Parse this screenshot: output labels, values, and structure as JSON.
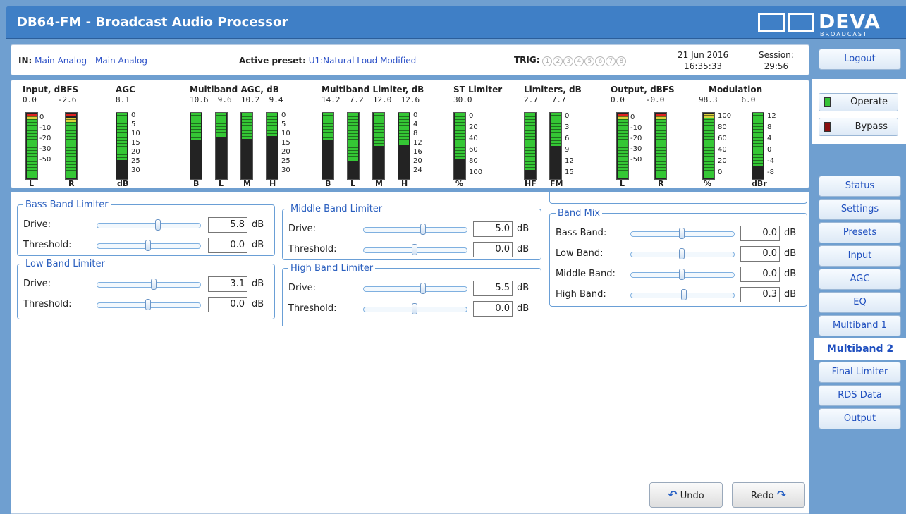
{
  "app": {
    "title": "DB64-FM - Broadcast Audio Processor",
    "logo_text": "DEVA",
    "logo_sub": "BROADCAST"
  },
  "info": {
    "in_label": "IN:",
    "in_value": "Main Analog - Main Analog",
    "preset_label": "Active preset:",
    "preset_value": "U1:Natural Loud Modified",
    "trig_label": "TRIG:",
    "trig": [
      "1",
      "2",
      "3",
      "4",
      "5",
      "6",
      "7",
      "8"
    ],
    "date": "21 Jun 2016",
    "time": "16:35:33",
    "session_label": "Session:",
    "session_value": "29:56"
  },
  "meters": {
    "input": {
      "title": "Input, dBFS",
      "l": "0.0",
      "r": "-2.6",
      "scale": [
        "0",
        "-10",
        "-20",
        "-30",
        "-50"
      ],
      "bars": [
        "L",
        "R"
      ]
    },
    "agc": {
      "title": "AGC",
      "v": "8.1",
      "scale": [
        "0",
        "5",
        "10",
        "15",
        "20",
        "25",
        "30"
      ],
      "bars": [
        "dB"
      ]
    },
    "mb_agc": {
      "title": "Multiband AGC, dB",
      "vals": [
        "10.6",
        "9.6",
        "10.2",
        "9.4"
      ],
      "scale": [
        "0",
        "5",
        "10",
        "15",
        "20",
        "25",
        "30"
      ],
      "bars": [
        "B",
        "L",
        "M",
        "H"
      ]
    },
    "mb_lim": {
      "title": "Multiband Limiter, dB",
      "vals": [
        "14.2",
        "7.2",
        "12.0",
        "12.6"
      ],
      "scale": [
        "0",
        "4",
        "8",
        "12",
        "16",
        "20",
        "24"
      ],
      "bars": [
        "B",
        "L",
        "M",
        "H"
      ]
    },
    "st_lim": {
      "title": "ST Limiter",
      "v": "30.0",
      "scale": [
        "0",
        "20",
        "40",
        "60",
        "80",
        "100"
      ],
      "bars": [
        "%"
      ]
    },
    "limiters": {
      "title": "Limiters, dB",
      "vals": [
        "2.7",
        "7.7"
      ],
      "scale": [
        "0",
        "3",
        "6",
        "9",
        "12",
        "15"
      ],
      "bars": [
        "HF",
        "FM"
      ]
    },
    "output": {
      "title": "Output, dBFS",
      "l": "0.0",
      "r": "-0.0",
      "scale": [
        "0",
        "-10",
        "-20",
        "-30",
        "-50"
      ],
      "bars": [
        "L",
        "R"
      ]
    },
    "modulation": {
      "title": "Modulation",
      "vals": [
        "98.3",
        "6.0"
      ],
      "scale_pct": [
        "100",
        "80",
        "60",
        "40",
        "20",
        "0"
      ],
      "scale_dbr": [
        "12",
        "8",
        "4",
        "0",
        "-4",
        "-8"
      ],
      "bars": [
        "%",
        "dBr"
      ]
    }
  },
  "groups": {
    "bass": {
      "legend": "Bass Band Limiter",
      "drive_label": "Drive:",
      "drive": "5.8",
      "threshold_label": "Threshold:",
      "threshold": "0.0",
      "unit": "dB"
    },
    "low": {
      "legend": "Low Band Limiter",
      "drive_label": "Drive:",
      "drive": "3.1",
      "threshold_label": "Threshold:",
      "threshold": "0.0",
      "unit": "dB"
    },
    "middle": {
      "legend": "Middle Band Limiter",
      "drive_label": "Drive:",
      "drive": "5.0",
      "threshold_label": "Threshold:",
      "threshold": "0.0",
      "unit": "dB"
    },
    "high": {
      "legend": "High Band Limiter",
      "drive_label": "Drive:",
      "drive": "5.5",
      "threshold_label": "Threshold:",
      "threshold": "0.0",
      "unit": "dB"
    },
    "mix": {
      "legend": "Band Mix",
      "bass_label": "Bass Band:",
      "bass": "0.0",
      "low_label": "Low Band:",
      "low": "0.0",
      "middle_label": "Middle Band:",
      "middle": "0.0",
      "high_label": "High Band:",
      "high": "0.3",
      "unit": "dB"
    }
  },
  "side": {
    "logout": "Logout",
    "operate": "Operate",
    "bypass": "Bypass",
    "nav": [
      "Status",
      "Settings",
      "Presets",
      "Input",
      "AGC",
      "EQ",
      "Multiband 1",
      "Multiband 2",
      "Final Limiter",
      "RDS Data",
      "Output"
    ],
    "active": "Multiband 2"
  },
  "actions": {
    "undo": "Undo",
    "redo": "Redo"
  },
  "colors": {
    "accent": "#3f7fc6",
    "link": "#2a4fc7",
    "meter_green": "#35c735",
    "meter_red": "#e02020",
    "meter_yellow": "#d9d23a"
  }
}
